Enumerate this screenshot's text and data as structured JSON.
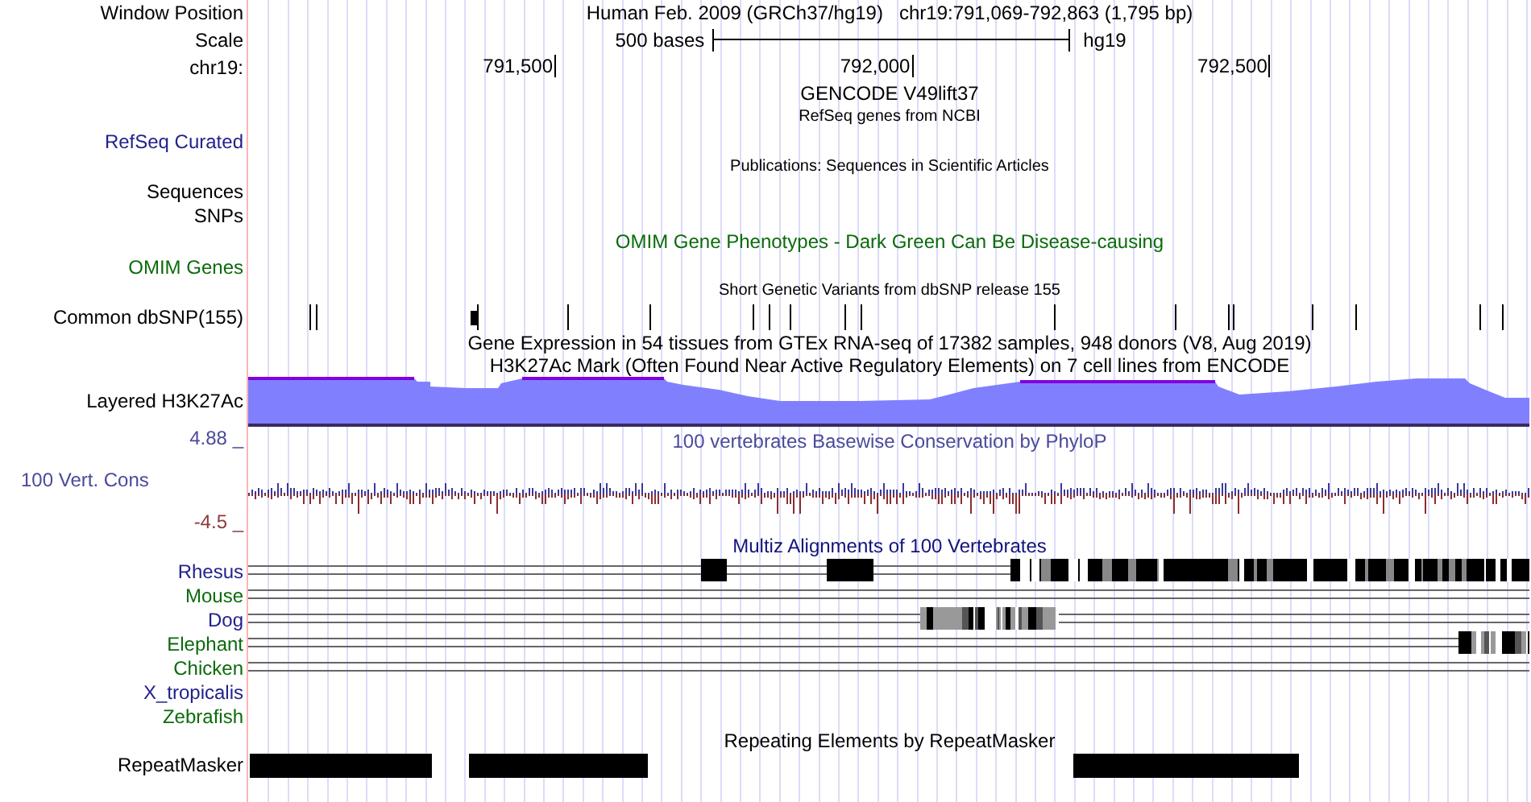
{
  "header": {
    "position_label": "Window Position",
    "assembly": "Human Feb. 2009 (GRCh37/hg19)",
    "position": "chr19:791,069-792,863 (1,795 bp)",
    "scale_label": "Scale",
    "scale_text": "500 bases",
    "scale_db": "hg19",
    "chrom_label": "chr19:",
    "ruler_ticks": [
      "791,500",
      "792,000",
      "792,500"
    ]
  },
  "tracks": [
    {
      "kind": "gene",
      "title": "GENCODE V49lift37",
      "subtitle": "RefSeq genes from NCBI",
      "label": "RefSeq Curated",
      "color": "#22228c"
    },
    {
      "kind": "publications",
      "title": "Publications: Sequences in Scientific Articles",
      "labels": [
        "Sequences",
        "SNPs"
      ],
      "color": "#000000"
    },
    {
      "kind": "omim",
      "title": "OMIM Gene Phenotypes - Dark Green Can Be Disease-causing",
      "label": "OMIM Genes",
      "color": "#0b6b0b"
    },
    {
      "kind": "snp",
      "title": "Short Genetic Variants from dbSNP release 155",
      "label": "Common dbSNP(155)",
      "color": "#000000"
    },
    {
      "kind": "signal",
      "titles": [
        "Gene Expression in 54 tissues from GTEx RNA-seq of 17382 samples, 948 donors (V8, Aug 2019)",
        "H3K27Ac Mark (Often Found Near Active Regulatory Elements) on 7 cell lines from ENCODE"
      ],
      "label": "Layered H3K27Ac",
      "color": "#000000"
    },
    {
      "kind": "conservation",
      "title": "100 vertebrates Basewise Conservation by PhyloP",
      "label": "100 Vert. Cons",
      "max": "4.88 _",
      "min": "-4.5 _",
      "color": "#4a4a9a"
    },
    {
      "kind": "multiz",
      "title": "Multiz Alignments of 100 Vertebrates",
      "species": [
        {
          "name": "Rhesus",
          "color": "#22228c",
          "aligned": true
        },
        {
          "name": "Mouse",
          "color": "#0b6b0b",
          "aligned": true
        },
        {
          "name": "Dog",
          "color": "#22228c",
          "aligned": true
        },
        {
          "name": "Elephant",
          "color": "#0b6b0b",
          "aligned": true
        },
        {
          "name": "Chicken",
          "color": "#0b6b0b",
          "aligned": true
        },
        {
          "name": "X_tropicalis",
          "color": "#22228c",
          "aligned": false
        },
        {
          "name": "Zebrafish",
          "color": "#0b6b0b",
          "aligned": false
        }
      ]
    },
    {
      "kind": "repeats",
      "title": "Repeating Elements by RepeatMasker",
      "label": "RepeatMasker",
      "color": "#000000"
    }
  ]
}
